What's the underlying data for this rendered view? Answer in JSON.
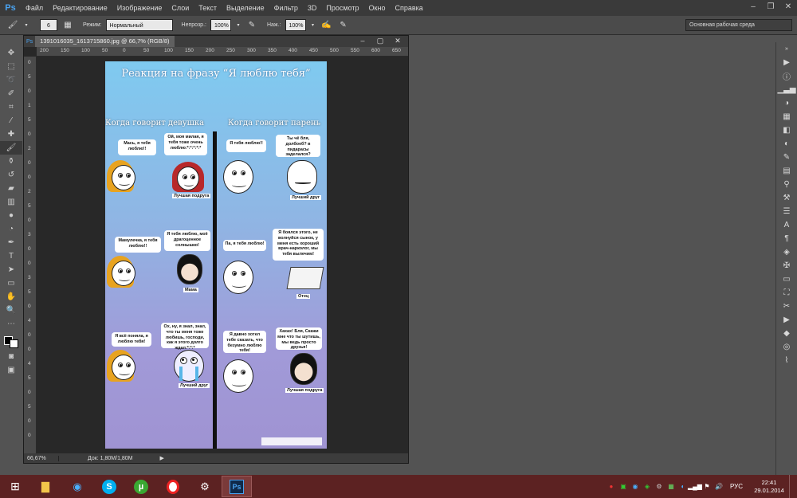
{
  "menubar": {
    "logo": "Ps",
    "items": [
      "Файл",
      "Редактирование",
      "Изображение",
      "Слои",
      "Текст",
      "Выделение",
      "Фильтр",
      "3D",
      "Просмотр",
      "Окно",
      "Справка"
    ]
  },
  "options": {
    "brush_size": "6",
    "mode_label": "Режим:",
    "mode_value": "Нормальный",
    "opacity_label": "Непрозр.:",
    "opacity_value": "100%",
    "pressure_label": "Наж.:",
    "pressure_value": "100%",
    "workspace": "Основная рабочая среда"
  },
  "document": {
    "tab_title": "1391016035_1613715860.jpg @ 66,7% (RGB/8)",
    "zoom": "66,67%",
    "doc_info": "Док: 1,80M/1,80M"
  },
  "hruler_ticks": [
    "200",
    "150",
    "100",
    "50",
    "0",
    "50",
    "100",
    "150",
    "200",
    "250",
    "300",
    "350",
    "400",
    "450",
    "500",
    "550",
    "600",
    "650"
  ],
  "vruler_ticks": [
    "0",
    "5",
    "0",
    "1",
    "5",
    "0",
    "2",
    "0",
    "0",
    "2",
    "5",
    "0",
    "3",
    "0",
    "0",
    "3",
    "5",
    "0",
    "4",
    "0",
    "0",
    "4",
    "5",
    "0",
    "5",
    "0",
    "0"
  ],
  "comic": {
    "title": "Реакция на фразу “Я люблю тебя”",
    "left_head": "Когда говорит девушка",
    "right_head": "Когда говорит парень",
    "bubbles": [
      "Мась, я тебя люблю!!",
      "Ой, моя милая, я тебя тоже очень люблю:*:*:*:*:*",
      "Я тебя люблю!!",
      "Ты чё бля, долбоеб? в пидарасы заделался?",
      "Мамулечка, я тебя люблю!!",
      "Я тебя люблю, моё драгоценное солнышко!",
      "Я боялся этого, не волнуйся сынок, у меня есть хороший врач-нарколог, мы тебя вылечим!",
      "Па, я тебя люблю!",
      "Я всё поняла, я люблю тебя!",
      "Ох, ну, я знал, знал, что ты меня тоже любишь, господи, как я этого долго ждал:*:*:*",
      "Я давно хотел тебе сказать, что безумно люблю тебя!",
      "Хахах! Бля, Скажи мне что ты шутишь, мы ведь просто друзья!"
    ],
    "captions": [
      "Лучшая подруга",
      "Лучший друг",
      "Мама",
      "Отец",
      "Лучший друг",
      "Лучшая подруга"
    ]
  },
  "taskbar": {
    "apps": [
      "start",
      "explorer",
      "itunes",
      "skype",
      "utorrent",
      "opera",
      "steam",
      "photoshop"
    ]
  },
  "tray": {
    "lang": "РУС",
    "time": "22:41",
    "date": "29.01.2014"
  }
}
